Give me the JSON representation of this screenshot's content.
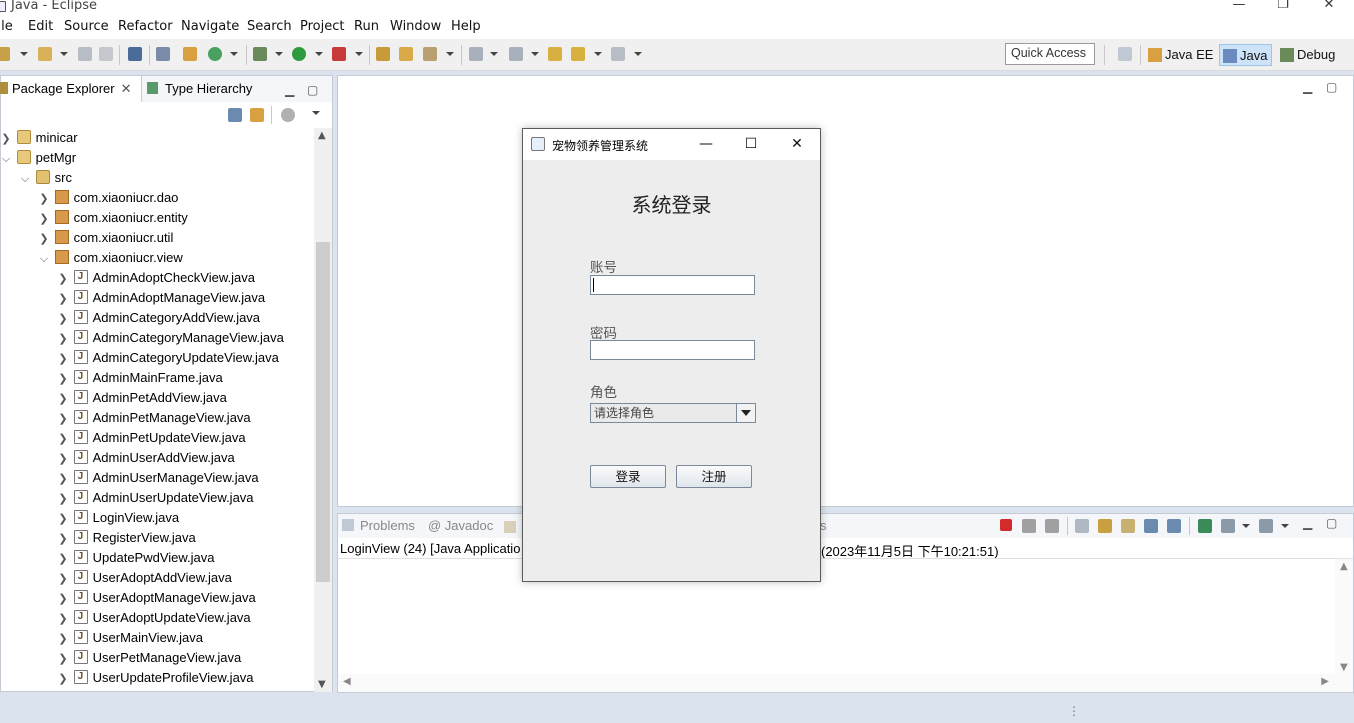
{
  "window": {
    "title": "Java - Eclipse",
    "controls": {
      "minimize": "—",
      "maximize": "❐",
      "close": "✕"
    }
  },
  "menu": [
    "File",
    "Edit",
    "Source",
    "Refactor",
    "Navigate",
    "Search",
    "Project",
    "Run",
    "Window",
    "Help"
  ],
  "toolbar": {
    "quick_access": "Quick Access",
    "perspectives": [
      {
        "label": "Java EE",
        "icon": "javaee-perspective-icon"
      },
      {
        "label": "Java",
        "icon": "java-perspective-icon",
        "active": true
      },
      {
        "label": "Debug",
        "icon": "debug-perspective-icon"
      }
    ]
  },
  "package_explorer": {
    "tabs": [
      {
        "label": "Package Explorer",
        "close": "✕"
      },
      {
        "label": "Type Hierarchy"
      }
    ],
    "tree": [
      {
        "label": "minicar",
        "icon": "project",
        "expanded": false
      },
      {
        "label": "petMgr",
        "icon": "project",
        "expanded": true
      },
      {
        "label": "src",
        "icon": "src",
        "expanded": true
      },
      {
        "label": "com.xiaoniucr.dao",
        "icon": "package",
        "expanded": false
      },
      {
        "label": "com.xiaoniucr.entity",
        "icon": "package",
        "expanded": false
      },
      {
        "label": "com.xiaoniucr.util",
        "icon": "package",
        "expanded": false
      },
      {
        "label": "com.xiaoniucr.view",
        "icon": "package",
        "expanded": true
      },
      {
        "label": "AdminAdoptCheckView.java",
        "icon": "java"
      },
      {
        "label": "AdminAdoptManageView.java",
        "icon": "java"
      },
      {
        "label": "AdminCategoryAddView.java",
        "icon": "java"
      },
      {
        "label": "AdminCategoryManageView.java",
        "icon": "java"
      },
      {
        "label": "AdminCategoryUpdateView.java",
        "icon": "java"
      },
      {
        "label": "AdminMainFrame.java",
        "icon": "java"
      },
      {
        "label": "AdminPetAddView.java",
        "icon": "java"
      },
      {
        "label": "AdminPetManageView.java",
        "icon": "java"
      },
      {
        "label": "AdminPetUpdateView.java",
        "icon": "java"
      },
      {
        "label": "AdminUserAddView.java",
        "icon": "java"
      },
      {
        "label": "AdminUserManageView.java",
        "icon": "java"
      },
      {
        "label": "AdminUserUpdateView.java",
        "icon": "java"
      },
      {
        "label": "LoginView.java",
        "icon": "java"
      },
      {
        "label": "RegisterView.java",
        "icon": "java"
      },
      {
        "label": "UpdatePwdView.java",
        "icon": "java"
      },
      {
        "label": "UserAdoptAddView.java",
        "icon": "java"
      },
      {
        "label": "UserAdoptManageView.java",
        "icon": "java"
      },
      {
        "label": "UserAdoptUpdateView.java",
        "icon": "java"
      },
      {
        "label": "UserMainView.java",
        "icon": "java"
      },
      {
        "label": "UserPetManageView.java",
        "icon": "java"
      },
      {
        "label": "UserUpdateProfileView.java",
        "icon": "java"
      }
    ]
  },
  "console": {
    "tabs": [
      "Problems",
      "@ Javadoc"
    ],
    "tab_suffix": "s",
    "header_left": "LoginView (24) [Java Applicatio",
    "header_right": "(2023年11月5日 下午10:21:51)"
  },
  "login_dialog": {
    "title": "宠物领养管理系统",
    "heading": "系统登录",
    "account_label": "账号",
    "account_value": "",
    "password_label": "密码",
    "password_value": "",
    "role_label": "角色",
    "role_selected": "请选择角色",
    "login_button": "登录",
    "register_button": "注册"
  }
}
